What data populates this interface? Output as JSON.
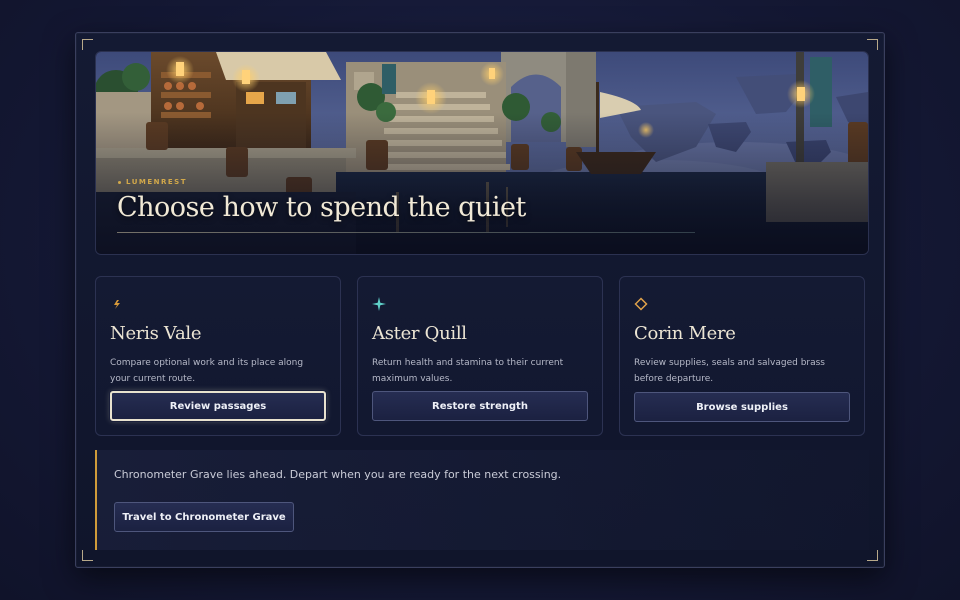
{
  "hero": {
    "location": "LUMENREST",
    "title": "Choose how to spend the quiet"
  },
  "cards": [
    {
      "icon": "lightning-icon",
      "icon_color": "#d89a3a",
      "name": "Neris Vale",
      "description": "Compare optional work and its place along your current route.",
      "button_label": "Review passages",
      "focused": true
    },
    {
      "icon": "sparkle-icon",
      "icon_color": "#5fd0c8",
      "name": "Aster Quill",
      "description": "Return health and stamina to their current maximum values.",
      "button_label": "Restore strength",
      "focused": false
    },
    {
      "icon": "diamond-icon",
      "icon_color": "#e0a24a",
      "name": "Corin Mere",
      "description": "Review supplies, seals and salvaged brass before departure.",
      "button_label": "Browse supplies",
      "focused": false
    }
  ],
  "travel": {
    "message": "Chronometer Grave lies ahead. Depart when you are ready for the next crossing.",
    "button_label": "Travel to Chronometer Grave",
    "accent_color": "#cf9b3a"
  }
}
